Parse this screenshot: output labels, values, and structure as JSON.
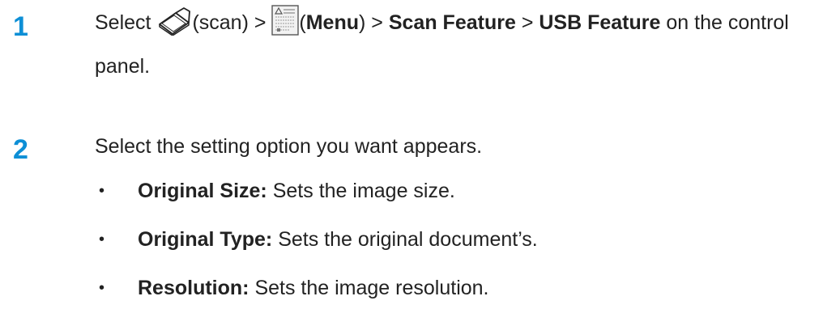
{
  "steps": [
    {
      "number": "1",
      "select": "Select",
      "scan_label": "(scan) >",
      "menu_open": "(",
      "menu_label": "Menu",
      "menu_close": ") >",
      "scan_feature": "Scan Feature",
      "sep": ">",
      "usb_feature": "USB Feature",
      "suffix": "on the control panel."
    },
    {
      "number": "2",
      "text": "Select the setting option you want appears."
    }
  ],
  "bullets": [
    {
      "term": "Original Size:",
      "desc": "Sets the image size."
    },
    {
      "term": "Original Type:",
      "desc": "Sets the original document’s."
    },
    {
      "term": "Resolution:",
      "desc": "Sets the image resolution."
    }
  ],
  "icons": {
    "scan": "scanner-icon",
    "menu": "menu-icon"
  },
  "colors": {
    "step_number": "#0d8fd6",
    "text": "#222222"
  }
}
